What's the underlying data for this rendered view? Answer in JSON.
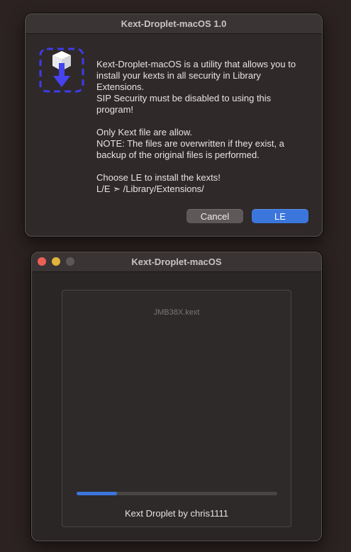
{
  "dialog": {
    "title": "Kext-Droplet-macOS 1.0",
    "icon": "kext-droplet-install-icon",
    "lines": [
      "Kext-Droplet-macOS is a utility that allows you to",
      "install your kexts in all security in Library",
      "Extensions.",
      "SIP Security must be disabled to using this",
      "program!",
      "",
      "Only Kext file are allow.",
      "NOTE: The files are overwritten if they exist, a",
      "backup of the original files is performed.",
      "",
      "Choose LE to install the kexts!",
      "L/E ➣ /Library/Extensions/"
    ],
    "cancel_label": "Cancel",
    "le_label": "LE",
    "accent": "#3b76dd"
  },
  "main_window": {
    "title": "Kext-Droplet-macOS",
    "file_name": "JMB38X.kext",
    "progress_percent": 20,
    "credit": "Kext Droplet by chris1111"
  }
}
